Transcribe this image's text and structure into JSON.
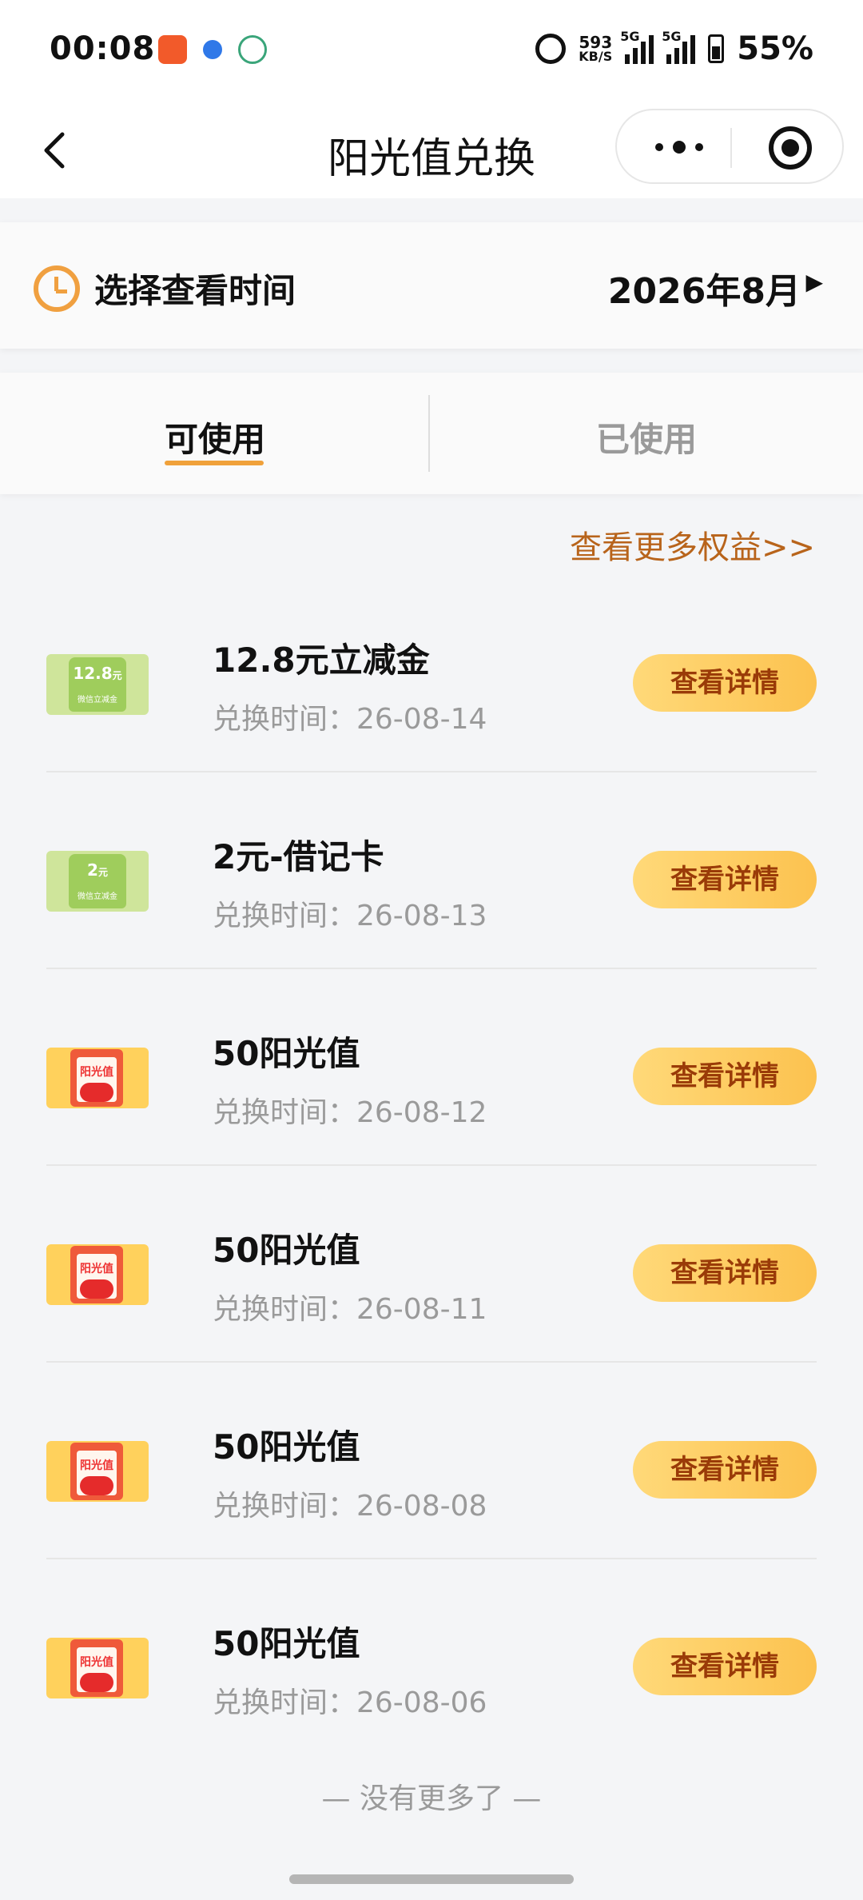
{
  "status_bar": {
    "time": "00:08",
    "net_speed_value": "593",
    "net_speed_unit": "KB/S",
    "signal1_label": "5G",
    "signal2_label": "5G",
    "battery": "55%"
  },
  "nav": {
    "back_icon": "chevron-left-icon",
    "title": "阳光值兑换",
    "more_icon": "more-icon",
    "close_icon": "target-icon"
  },
  "picker": {
    "label": "选择查看时间",
    "value": "2026年8月",
    "arrow": "▶"
  },
  "tabs": [
    {
      "label": "可使用",
      "active": true
    },
    {
      "label": "已使用",
      "active": false
    }
  ],
  "more_link": "查看更多权益>>",
  "items": [
    {
      "type": "coupon",
      "thumb_text": "12.8",
      "thumb_unit": "元",
      "thumb_sub": "微信立减金",
      "title": "12.8元立减金",
      "date": "兑换时间：26-08-14",
      "button": "查看详情"
    },
    {
      "type": "coupon",
      "thumb_text": "2",
      "thumb_unit": "元",
      "thumb_sub": "微信立减金",
      "title": "2元-借记卡",
      "date": "兑换时间：26-08-13",
      "button": "查看详情"
    },
    {
      "type": "sunshine",
      "thumb_text": "阳光值",
      "title": "50阳光值",
      "date": "兑换时间：26-08-12",
      "button": "查看详情"
    },
    {
      "type": "sunshine",
      "thumb_text": "阳光值",
      "title": "50阳光值",
      "date": "兑换时间：26-08-11",
      "button": "查看详情"
    },
    {
      "type": "sunshine",
      "thumb_text": "阳光值",
      "title": "50阳光值",
      "date": "兑换时间：26-08-08",
      "button": "查看详情"
    },
    {
      "type": "sunshine",
      "thumb_text": "阳光值",
      "title": "50阳光值",
      "date": "兑换时间：26-08-06",
      "button": "查看详情"
    }
  ],
  "end_text": "— 没有更多了 —",
  "colors": {
    "accent_orange": "#f0a13a",
    "link_brown": "#b8641b",
    "button_text": "#9a3b08",
    "button_fill": "#fcc24f"
  }
}
